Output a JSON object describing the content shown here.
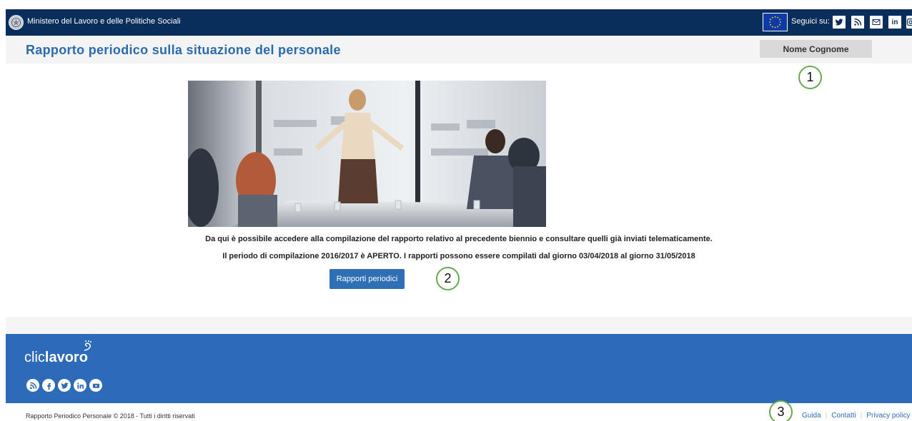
{
  "topbar": {
    "ministry_name": "Ministero del Lavoro e delle Politiche Sociali",
    "follow_label": "Seguici su:",
    "social_icons": [
      "twitter-icon",
      "rss-icon",
      "mail-icon",
      "linkedin-icon",
      "instagram-icon"
    ],
    "linkedin_text": "in",
    "background_color": "#0a2e5c"
  },
  "header": {
    "title": "Rapporto periodico sulla situazione del personale",
    "user_name": "Nome Cognome",
    "title_color": "#2a6bb0"
  },
  "main": {
    "info_line_1": "Da qui è possibile accedere alla compilazione del rapporto relativo al precedente biennio e consultare quelli già inviati telematicamente.",
    "info_line_2": "Il periodo di compilazione 2016/2017 è APERTO. I rapporti possono essere compilati dal giorno 03/04/2018 al giorno 31/05/2018",
    "button_label": "Rapporti periodici",
    "button_color": "#2e6fb5"
  },
  "callouts": [
    "1",
    "2",
    "3"
  ],
  "footer": {
    "logo_thin": "clic",
    "logo_bold": "lavoro",
    "social_icons": [
      "rss-icon",
      "facebook-icon",
      "twitter-icon",
      "linkedin-icon",
      "youtube-icon"
    ],
    "copyright": "Rapporto Periodico Personale © 2018 - Tutti i diritti riservati",
    "links": [
      "Guida",
      "Contatti",
      "Privacy policy"
    ],
    "background_color": "#2d6bb8"
  }
}
